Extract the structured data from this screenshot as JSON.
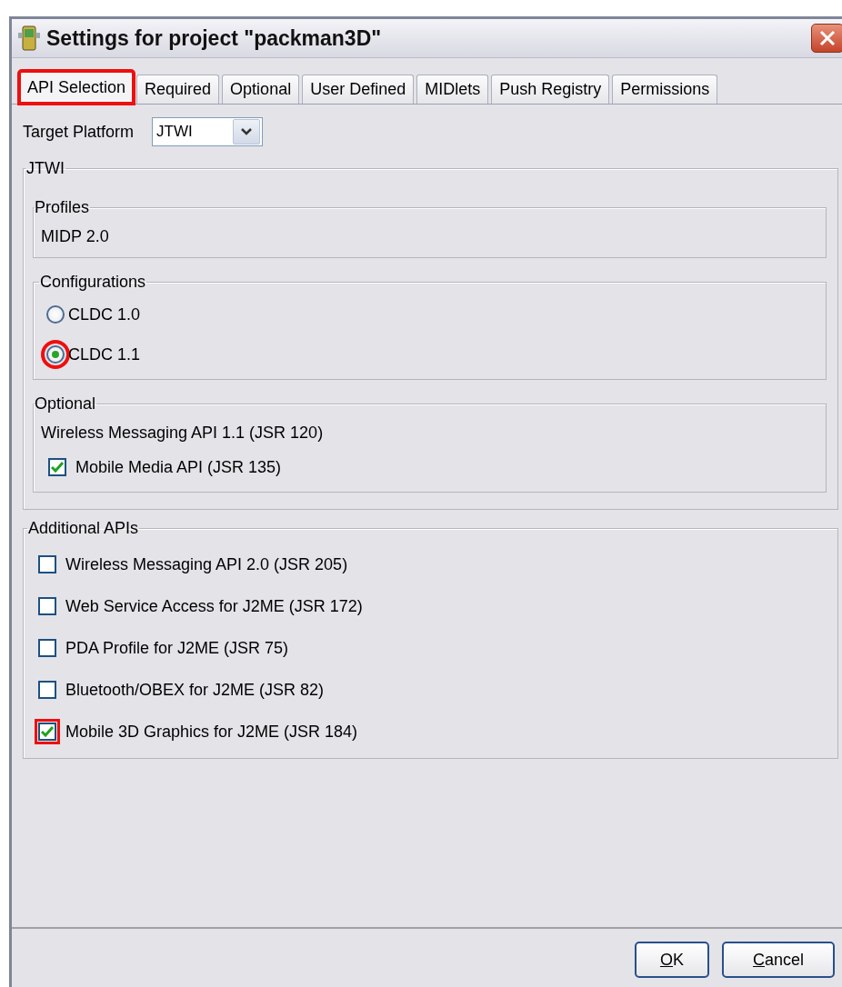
{
  "window": {
    "title": "Settings for project \"packman3D\""
  },
  "tabs": [
    {
      "label": "API Selection",
      "selected": true,
      "highlighted": true
    },
    {
      "label": "Required",
      "selected": false,
      "highlighted": false
    },
    {
      "label": "Optional",
      "selected": false,
      "highlighted": false
    },
    {
      "label": "User Defined",
      "selected": false,
      "highlighted": false
    },
    {
      "label": "MIDlets",
      "selected": false,
      "highlighted": false
    },
    {
      "label": "Push Registry",
      "selected": false,
      "highlighted": false
    },
    {
      "label": "Permissions",
      "selected": false,
      "highlighted": false
    }
  ],
  "target_platform": {
    "label": "Target Platform",
    "value": "JTWI"
  },
  "platform_group": {
    "title": "JTWI",
    "profiles": {
      "title": "Profiles",
      "items": [
        "MIDP 2.0"
      ]
    },
    "configurations": {
      "title": "Configurations",
      "options": [
        {
          "label": "CLDC 1.0",
          "selected": false,
          "highlighted": false
        },
        {
          "label": "CLDC 1.1",
          "selected": true,
          "highlighted": true
        }
      ]
    },
    "optional": {
      "title": "Optional",
      "items": [
        {
          "kind": "text",
          "label": "Wireless Messaging API 1.1 (JSR 120)"
        },
        {
          "kind": "checkbox",
          "label": "Mobile Media API (JSR 135)",
          "checked": true,
          "highlighted": false
        }
      ]
    }
  },
  "additional_apis": {
    "title": "Additional APIs",
    "items": [
      {
        "label": "Wireless Messaging API 2.0 (JSR 205)",
        "checked": false,
        "highlighted": false
      },
      {
        "label": "Web Service Access for J2ME (JSR 172)",
        "checked": false,
        "highlighted": false
      },
      {
        "label": "PDA Profile for J2ME (JSR 75)",
        "checked": false,
        "highlighted": false
      },
      {
        "label": "Bluetooth/OBEX for J2ME (JSR 82)",
        "checked": false,
        "highlighted": false
      },
      {
        "label": "Mobile 3D Graphics for J2ME (JSR 184)",
        "checked": true,
        "highlighted": true
      }
    ]
  },
  "buttons": [
    {
      "label": "OK",
      "mnemonic_underlined": true
    },
    {
      "label": "Cancel",
      "mnemonic_underlined": true
    }
  ]
}
